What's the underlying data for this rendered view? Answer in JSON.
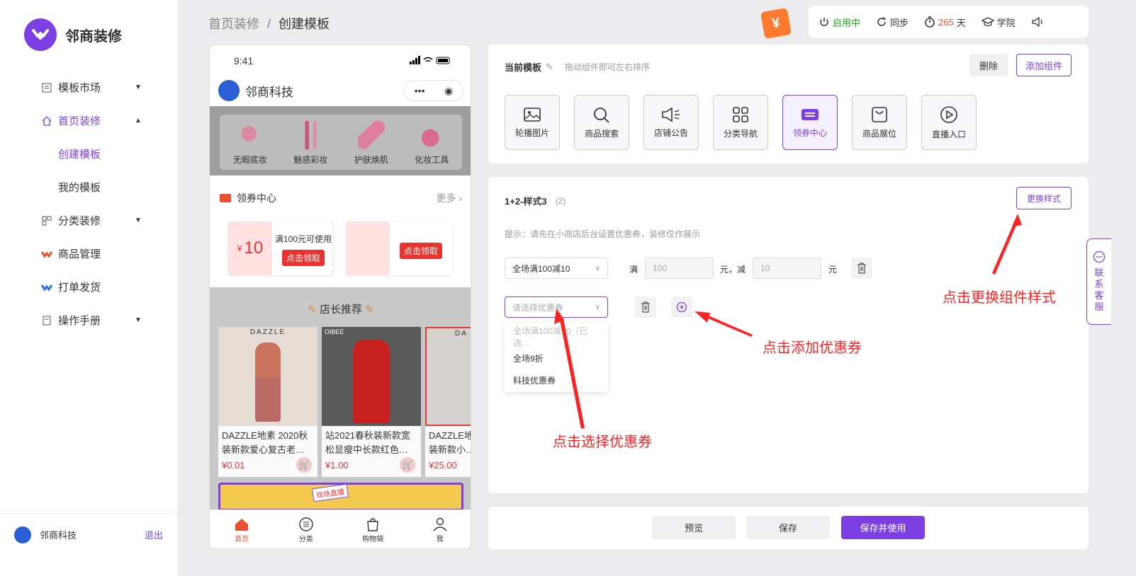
{
  "brand": {
    "name": "邻商装修"
  },
  "sidebar": {
    "items": [
      {
        "label": "模板市场",
        "icon": "template-icon"
      },
      {
        "label": "首页装修",
        "icon": "home-icon"
      },
      {
        "label": "创建模板"
      },
      {
        "label": "我的模板"
      },
      {
        "label": "分类装修",
        "icon": "grid-icon"
      },
      {
        "label": "商品管理",
        "icon": "goods-icon"
      },
      {
        "label": "打单发货",
        "icon": "ship-icon"
      },
      {
        "label": "操作手册",
        "icon": "manual-icon"
      }
    ],
    "footer": {
      "name": "邻商科技",
      "logout": "退出"
    }
  },
  "breadcrumb": {
    "parent": "首页装修",
    "sep": "/",
    "current": "创建模板"
  },
  "topbar": {
    "hongbao": "¥",
    "status": "启用中",
    "sync": "同步",
    "days_num": "265",
    "days_unit": "天",
    "academy": "学院"
  },
  "phone": {
    "time": "9:41",
    "shop": "邻商科技",
    "categories": [
      "无暇底妆",
      "魅惑彩妆",
      "护肤焕肌",
      "化妆工具"
    ],
    "coupon_title": "领券中心",
    "more": "更多",
    "coupon1": {
      "currency": "¥",
      "amount": "10",
      "cond": "满100元可使用",
      "btn": "点击领取"
    },
    "coupon2": {
      "btn": "点击领取"
    },
    "recommend": "店长推荐",
    "products": [
      {
        "title": "DAZZLE地素 2020秋装新款爱心复古老…",
        "price": "¥0.01",
        "brand": "DAZZLE"
      },
      {
        "title": "站2021春秋装新款宽松显瘦中长款红色…",
        "price": "¥1.00",
        "brand": "OIBEE"
      },
      {
        "title": "DAZZLE地素 2020秋装新款小…",
        "price": "¥25.00",
        "brand": "DA"
      }
    ],
    "banner_tag": "现场直播",
    "tabs": [
      "首页",
      "分类",
      "购物袋",
      "我"
    ]
  },
  "panel1": {
    "title": "当前模板",
    "hint": "拖动组件即可左右排序",
    "delete": "删除",
    "add": "添加组件",
    "components": [
      "轮播图片",
      "商品搜索",
      "店铺公告",
      "分类导航",
      "领券中心",
      "商品展位",
      "直播入口"
    ]
  },
  "panel2": {
    "title": "1+2-样式3",
    "count": "(2)",
    "change": "更换样式",
    "tip": "提示：请先在小商店后台设置优惠券，装修仅作展示",
    "row1": {
      "select": "全场满100减10",
      "man": "满",
      "man_ph": "100",
      "yuan_jian": "元，减",
      "jian_ph": "10",
      "yuan": "元"
    },
    "row2": {
      "placeholder": "请选择优惠券"
    },
    "dropdown": [
      "全场满100减10（已选…",
      "全场9折",
      "科技优惠券"
    ]
  },
  "annotations": {
    "select": "点击选择优惠券",
    "add": "点击添加优惠券",
    "change": "点击更换组件样式"
  },
  "kefu": [
    "联",
    "系",
    "客",
    "服"
  ],
  "footer": {
    "preview": "预览",
    "save": "保存",
    "save_use": "保存并使用"
  },
  "colors": {
    "accent": "#7b3fe4",
    "annotation": "#ff2222",
    "green": "#1aad19"
  }
}
